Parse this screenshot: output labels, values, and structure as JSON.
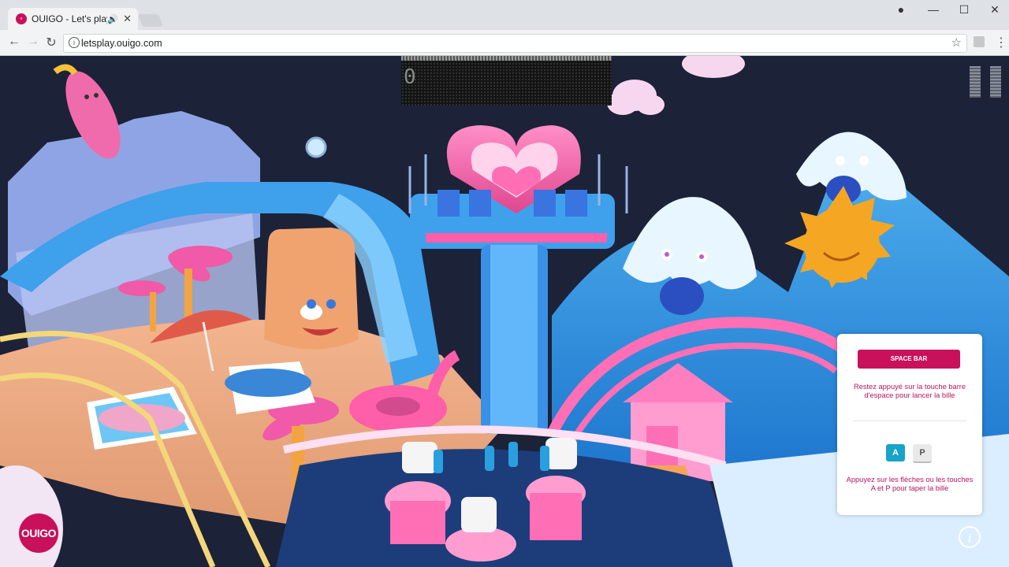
{
  "browser": {
    "tab_title": "OUIGO - Let's play",
    "tab_favicon": "ouigo",
    "url": "letsplay.ouigo.com",
    "icons": [
      "back-icon",
      "forward-icon",
      "reload-icon",
      "info-icon",
      "star-icon",
      "extension-icon",
      "menu-icon",
      "profile-icon",
      "minimize-icon",
      "maximize-icon",
      "close-icon",
      "speaker-icon"
    ]
  },
  "game": {
    "scoreboard_digit": "0",
    "instructions": {
      "button_label": "SPACE BAR",
      "launch_text": "Restez appuyé sur la touche barre d'espace pour lancer la bille",
      "key_a": "A",
      "key_p": "P",
      "flip_text": "Appuyez sur les flèches ou les touches A et P pour taper la bille"
    },
    "logo_text": "OUIGO",
    "info_label": "i"
  },
  "colors": {
    "brand": "#c8105b",
    "accent_blue": "#18a3c9",
    "sky": "#1c2238"
  }
}
